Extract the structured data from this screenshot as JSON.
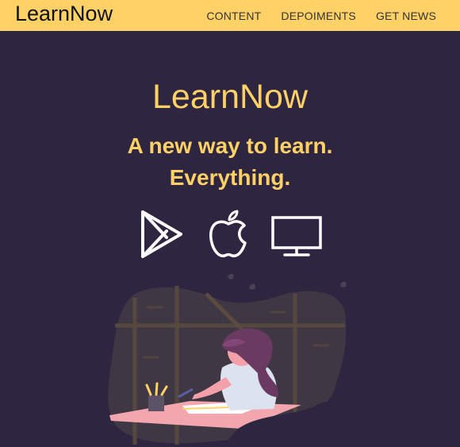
{
  "header": {
    "brand": "LearnNow",
    "nav": [
      {
        "label": "CONTENT"
      },
      {
        "label": "DEPOIMENTS"
      },
      {
        "label": "GET NEWS"
      }
    ]
  },
  "hero": {
    "title": "LearnNow",
    "subtitle_line1": "A new way to learn.",
    "subtitle_line2": "Everything."
  },
  "platforms": [
    {
      "icon": "google-play-icon"
    },
    {
      "icon": "apple-icon"
    },
    {
      "icon": "desktop-monitor-icon"
    }
  ],
  "colors": {
    "accent": "#ffd166",
    "background": "#2e2541",
    "nav_text": "#333333"
  }
}
